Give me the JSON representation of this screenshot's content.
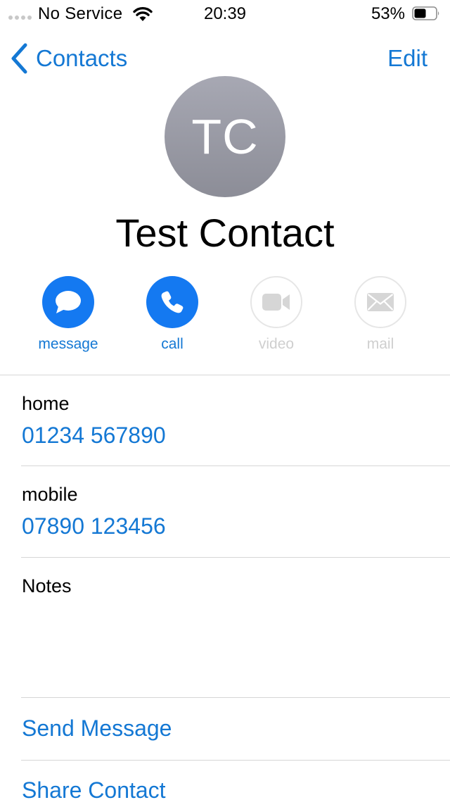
{
  "status_bar": {
    "carrier": "No Service",
    "time": "20:39",
    "battery_percent": "53%"
  },
  "nav": {
    "back_label": "Contacts",
    "edit_label": "Edit"
  },
  "contact": {
    "initials": "TC",
    "name": "Test Contact"
  },
  "actions": [
    {
      "label": "message",
      "icon": "message-bubble-icon",
      "enabled": true
    },
    {
      "label": "call",
      "icon": "phone-icon",
      "enabled": true
    },
    {
      "label": "video",
      "icon": "video-camera-icon",
      "enabled": false
    },
    {
      "label": "mail",
      "icon": "envelope-icon",
      "enabled": false
    }
  ],
  "fields": [
    {
      "label": "home",
      "value": "01234 567890"
    },
    {
      "label": "mobile",
      "value": "07890 123456"
    }
  ],
  "notes": {
    "label": "Notes",
    "value": ""
  },
  "links": {
    "send_message": "Send Message",
    "share_contact": "Share Contact"
  },
  "colors": {
    "accent": "#1478d4",
    "action_fill": "#1479f1",
    "avatar_top": "#a7a8b3",
    "avatar_bottom": "#8c8d97",
    "disabled": "#cfcfcf",
    "separator": "#d6d6d6"
  }
}
